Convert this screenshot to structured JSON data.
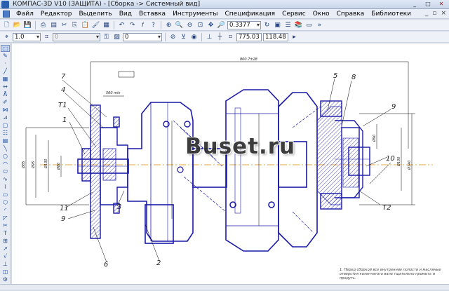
{
  "window": {
    "title": "КОМПАС-3D V10 (ЗАЩИТА) - [Сборка -> Системный вид]",
    "controls": [
      "_",
      "□",
      "✕"
    ]
  },
  "menu": {
    "items": [
      "Файл",
      "Редактор",
      "Выделить",
      "Вид",
      "Вставка",
      "Инструменты",
      "Спецификация",
      "Сервис",
      "Окно",
      "Справка",
      "Библиотеки"
    ],
    "doc_controls": [
      "_",
      "▫",
      "×"
    ]
  },
  "toolbar1": {
    "zoom_value": "0.3377"
  },
  "toolbar2": {
    "line_scale": "1.0",
    "style_value": "0",
    "layer_value": "0",
    "coord_x": "775.03",
    "coord_y": "118.48"
  },
  "drawing": {
    "callouts": [
      "7",
      "4",
      "T1",
      "1",
      "11",
      "9",
      "6",
      "3",
      "2",
      "5",
      "8",
      "9",
      "10",
      "T2"
    ],
    "dimensions": [
      "800.7±28",
      "560 min",
      "Ø85",
      "Ø95",
      "Ø130",
      "Ø80",
      "Ø90",
      "Ø100",
      "Ø140"
    ],
    "watermark": "Buset.ru",
    "note": "1. Перед сборкой все внутренние полости и масляные отверстия коленчатого вала тщательно промыть и продуть."
  }
}
